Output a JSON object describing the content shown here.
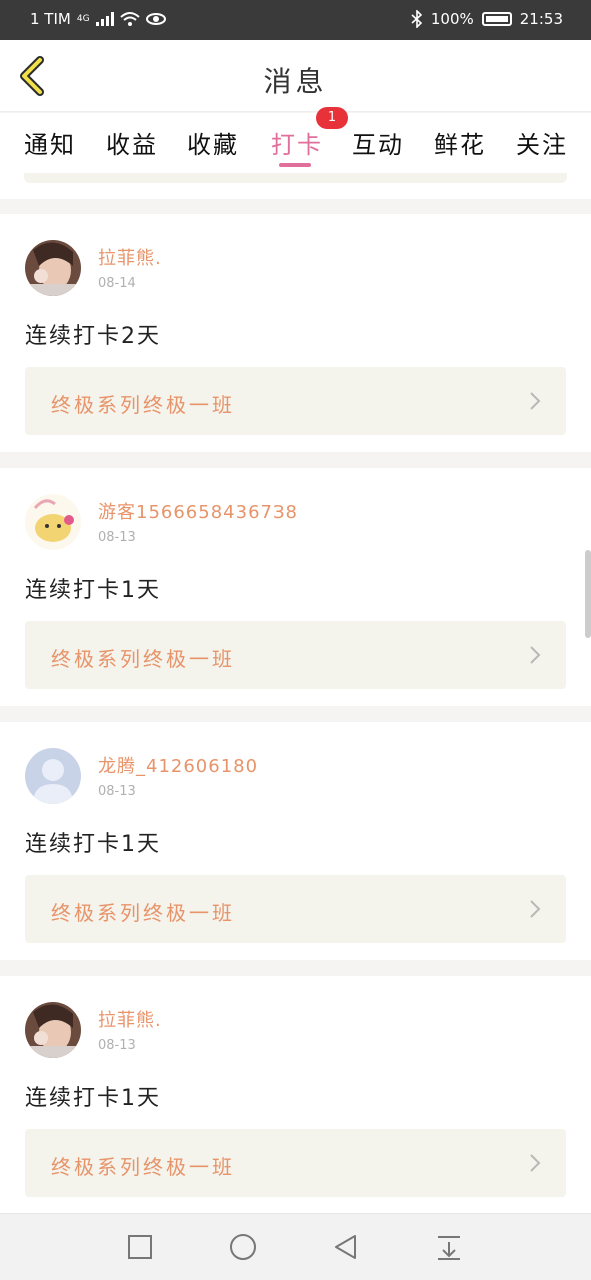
{
  "status_bar": {
    "carrier": "1 TIM",
    "network": "4G",
    "battery": "100%",
    "time": "21:53"
  },
  "header": {
    "title": "消息"
  },
  "tabs": [
    {
      "label": "通知"
    },
    {
      "label": "收益"
    },
    {
      "label": "收藏"
    },
    {
      "label": "打卡",
      "active": true,
      "badge": "1"
    },
    {
      "label": "互动"
    },
    {
      "label": "鲜花"
    },
    {
      "label": "关注"
    }
  ],
  "colors": {
    "accent_pink": "#e06f9c",
    "name_orange": "#e8946a",
    "badge_red": "#e8323a"
  },
  "messages": [
    {
      "username": "拉菲熊.",
      "date": "08-14",
      "text": "连续打卡2天",
      "course": "终极系列终极一班",
      "avatar": "photo-avatar"
    },
    {
      "username": "游客15666584367З8",
      "date": "08-13",
      "text": "连续打卡1天",
      "course": "终极系列终极一班",
      "avatar": "cartoon-avatar"
    },
    {
      "username": "龙腾_412606180",
      "date": "08-13",
      "text": "连续打卡1天",
      "course": "终极系列终极一班",
      "avatar": "default-avatar"
    },
    {
      "username": "拉菲熊.",
      "date": "08-13",
      "text": "连续打卡1天",
      "course": "终极系列终极一班",
      "avatar": "photo-avatar"
    }
  ],
  "nav_icons": [
    "recent-apps-icon",
    "home-icon",
    "back-icon",
    "notification-pull-icon"
  ]
}
